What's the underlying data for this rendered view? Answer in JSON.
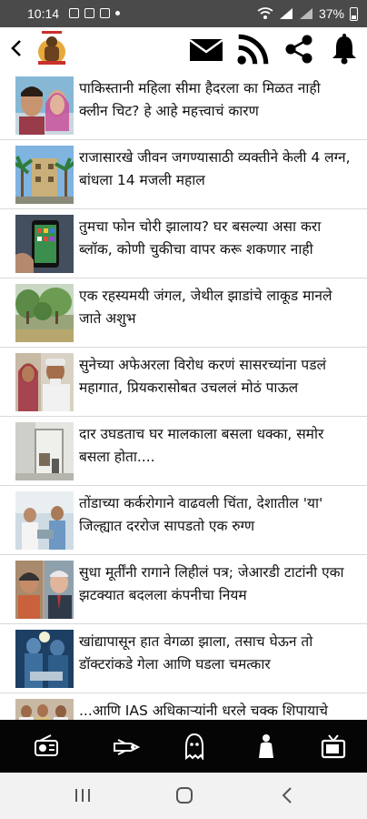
{
  "status": {
    "time": "10:14",
    "battery": "37%"
  },
  "header": {
    "back_icon": "chevron-left-icon",
    "logo": "temple-logo",
    "actions": [
      "mail-icon",
      "rss-icon",
      "share-icon",
      "bell-icon"
    ]
  },
  "articles": [
    {
      "title": "पाकिस्तानी महिला सीमा हैदरला का मिळत नाही क्लीन चिट? हे आहे महत्त्वाचं कारण",
      "thumb": "woman-portrait"
    },
    {
      "title": "राजासारखे जीवन जगण्यासाठी व्यक्तीने केली 4 लग्न, बांधला 14 मजली महाल",
      "thumb": "building-palms"
    },
    {
      "title": "तुमचा फोन चोरी झालाय? घर बसल्या असा करा ब्लॉक, कोणी चुकीचा वापर करू शकणार नाही",
      "thumb": "phone-in-pocket"
    },
    {
      "title": "एक रहस्यमयी जंगल, जेथील झाडांचे लाकूड मानले जाते अशुभ",
      "thumb": "forest"
    },
    {
      "title": "सुनेच्या अफेअरला विरोध करणं सासरच्यांना पडलं महागात, प्रियकरासोबत उचललं मोठं पाऊल",
      "thumb": "elderly-couple"
    },
    {
      "title": "दार उघडताच घर मालकाला बसला धक्का, समोर बसला होता....",
      "thumb": "room-door"
    },
    {
      "title": "तोंडाच्या कर्करोगाने वाढवली चिंता, देशातील 'या' जिल्ह्यात दररोज सापडतो एक रुग्ण",
      "thumb": "doctors"
    },
    {
      "title": "सुधा मूर्तींनी रागाने लिहीलं पत्र; जेआरडी टाटांनी एका झटक्यात बदलला कंपनीचा नियम",
      "thumb": "two-portraits"
    },
    {
      "title": "खांद्यापासून हात वेगळा झाला, तसाच घेऊन तो डॉक्टरांकडे गेला आणि घडला चमत्कार",
      "thumb": "surgery"
    },
    {
      "title": "...आणि IAS अधिकाऱ्यांनी धरले चक्क शिपायाचे",
      "thumb": "group-photo"
    }
  ],
  "bottom_nav": [
    "radio-icon",
    "stream-icon",
    "ghost-icon",
    "idol-icon",
    "tv-icon"
  ],
  "system_nav": [
    "recents-icon",
    "home-icon",
    "back-icon"
  ]
}
